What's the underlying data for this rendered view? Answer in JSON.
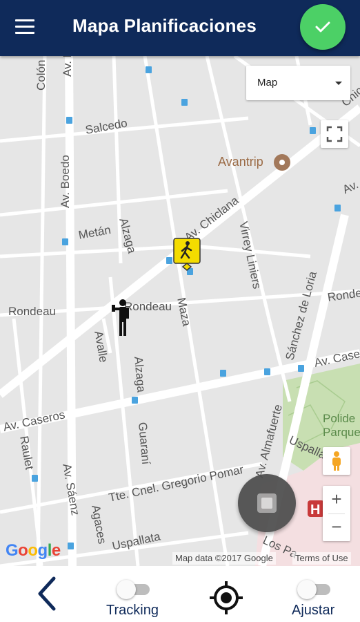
{
  "appbar": {
    "title": "Mapa Planificaciones",
    "background": "#0f2a5a",
    "menu_icon": "hamburger-menu-icon",
    "confirm_icon": "check-icon",
    "confirm_color": "#4cd066"
  },
  "map": {
    "map_type": {
      "selected": "Map"
    },
    "streets": {
      "colon": "Colón",
      "av_boedo_top": "Av. Boedo",
      "salcedo": "Salcedo",
      "chiclana_edge": "Chic",
      "av_edge_top": "Av.",
      "metan": "Metán",
      "alzaga_top": "Alzaga",
      "av_chiclana": "Av. Chiclana",
      "virrey_liniers": "Virrey Liniers",
      "rondeau_left": "Rondeau",
      "rondeau_mid": "Rondeau",
      "rondeau_right": "Rondeau",
      "maza": "Maza",
      "sanchez_loria": "Sánchez de Loria",
      "avalle": "Avalle",
      "av_boedo_mid": "Av. Boedo",
      "alzaga_bottom": "Alzaga",
      "av_caseros_right": "Av. Case",
      "av_caseros_left": "Av. Caseros",
      "raulet": "Raulet",
      "guarani": "Guaraní",
      "av_almafuerte": "Av. Almafuerte",
      "uspalla_right": "Uspalla",
      "tte_cnel_gregorio_pomar": "Tte. Cnel. Gregorio Pomar",
      "av_saenz": "Av. Sáenz",
      "agaces": "Agaces",
      "uspallata": "Uspallata",
      "los_pa": "Los Pa"
    },
    "pois": {
      "avantrip": "Avantrip",
      "park_line1": "Polide",
      "park_line2": "Parque P"
    },
    "google_logo": "Google",
    "attribution": "Map data ©2017 Google",
    "terms": "Terms of Use",
    "controls": {
      "fullscreen_icon": "fullscreen-icon",
      "pegman_icon": "pegman-icon",
      "zoom_in": "+",
      "zoom_out": "−",
      "stop_icon": "stop-icon"
    },
    "markers": {
      "pedestrian_sign_icon": "pedestrian-sign-icon",
      "person_icon": "person-marker-icon"
    }
  },
  "bottom": {
    "back_icon": "chevron-left-icon",
    "tracking_label": "Tracking",
    "tracking_on": false,
    "center_icon": "my-location-icon",
    "ajustar_label": "Ajustar",
    "ajustar_on": false
  }
}
